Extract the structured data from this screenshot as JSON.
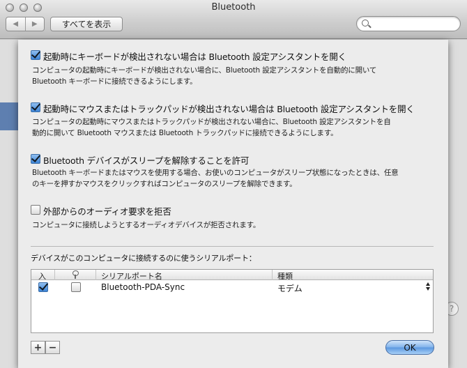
{
  "window": {
    "title": "Bluetooth"
  },
  "toolbar": {
    "back_icon": "◀",
    "forward_icon": "▶",
    "show_all_label": "すべてを表示",
    "search_placeholder": ""
  },
  "options": [
    {
      "checked": true,
      "title": "起動時にキーボードが検出されない場合は Bluetooth 設定アシスタントを開く",
      "desc_lines": [
        "コンピュータの起動時にキーボードが検出されない場合に、Bluetooth 設定アシスタントを自動的に開いて",
        "Bluetooth キーボードに接続できるようにします。"
      ]
    },
    {
      "checked": true,
      "title": "起動時にマウスまたはトラックパッドが検出されない場合は Bluetooth 設定アシスタントを開く",
      "desc_lines": [
        "コンピュータの起動時にマウスまたはトラックパッドが検出されない場合に、Bluetooth 設定アシスタントを自",
        "動的に開いて Bluetooth マウスまたは Bluetooth トラックパッドに接続できるようにします。"
      ]
    },
    {
      "checked": true,
      "title": "Bluetooth デバイスがスリープを解除することを許可",
      "desc_lines": [
        "Bluetooth キーボードまたはマウスを使用する場合、お使いのコンピュータがスリープ状態になったときは、任意",
        "のキーを押すかマウスをクリックすればコンピュータのスリープを解除できます。"
      ]
    },
    {
      "checked": false,
      "title": "外部からのオーディオ要求を拒否",
      "desc_lines": [
        "コンピュータに接続しようとするオーディオデバイスが拒否されます。"
      ]
    }
  ],
  "serial_ports": {
    "label": "デバイスがこのコンピュータに接続するのに使うシリアルポート：",
    "columns": {
      "enabled": "入",
      "secure": "",
      "name": "シリアルポート名",
      "type": "種類"
    },
    "rows": [
      {
        "enabled": true,
        "secure": false,
        "name": "Bluetooth-PDA-Sync",
        "type": "モデム"
      }
    ]
  },
  "buttons": {
    "add": "+",
    "remove": "−",
    "ok": "OK"
  }
}
